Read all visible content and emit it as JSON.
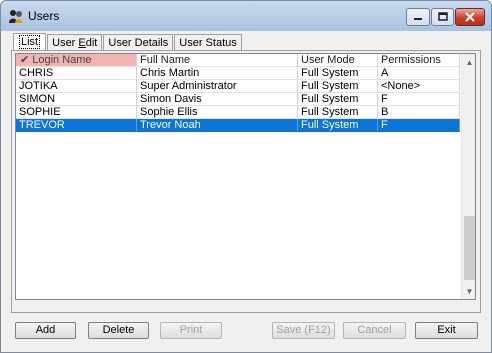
{
  "window": {
    "title": "Users"
  },
  "tabs": [
    {
      "label": "List"
    },
    {
      "label_prefix": "User ",
      "label_accel": "E",
      "label_suffix": "dit"
    },
    {
      "label": "User Details"
    },
    {
      "label": "User Status"
    }
  ],
  "grid": {
    "columns": [
      "Login Name",
      "Full Name",
      "User Mode",
      "Permissions"
    ],
    "sorted_column": "Login Name",
    "rows": [
      {
        "login": "CHRIS",
        "full_name": "Chris Martin",
        "mode": "Full System",
        "permissions": "A"
      },
      {
        "login": "JOTIKA",
        "full_name": "Super Administrator",
        "mode": "Full System",
        "permissions": "<None>"
      },
      {
        "login": "SIMON",
        "full_name": "Simon Davis",
        "mode": "Full System",
        "permissions": "F"
      },
      {
        "login": "SOPHIE",
        "full_name": "Sophie Ellis",
        "mode": "Full System",
        "permissions": "B"
      },
      {
        "login": "TREVOR",
        "full_name": "Trevor Noah",
        "mode": "Full System",
        "permissions": "F"
      }
    ],
    "selected_row": "TREVOR"
  },
  "buttons": {
    "add": "Add",
    "delete": "Delete",
    "print": "Print",
    "save": "Save (F12)",
    "cancel": "Cancel",
    "exit": "Exit"
  },
  "colors": {
    "selection": "#0b74d6",
    "sorted_header": "#f2b3b3",
    "close_button": "#c9412b"
  }
}
